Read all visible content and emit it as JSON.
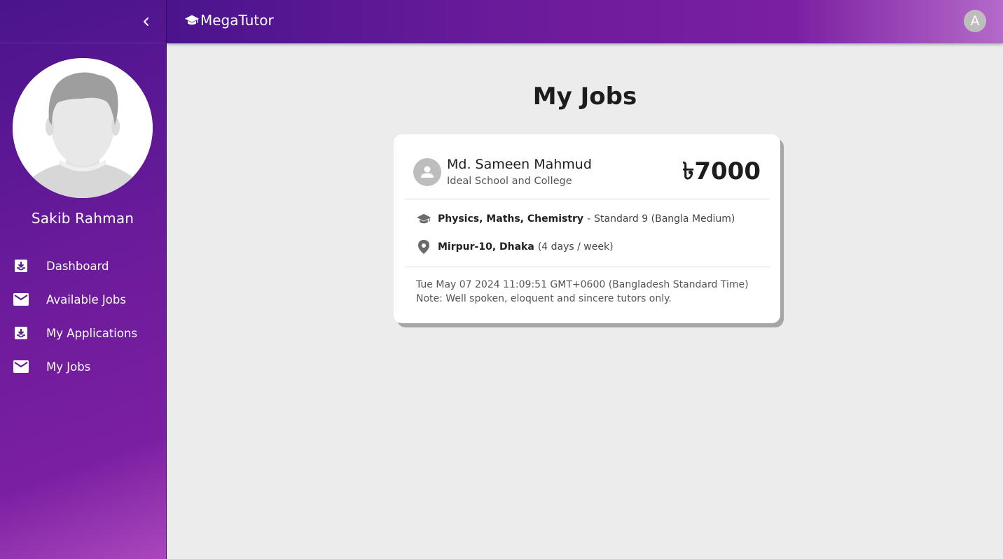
{
  "app": {
    "brand": "MegaTutor",
    "user_initial": "A"
  },
  "sidebar": {
    "user_name": "Sakib Rahman",
    "items": [
      {
        "label": "Dashboard",
        "icon": "inbox-download-icon"
      },
      {
        "label": "Available Jobs",
        "icon": "mail-icon"
      },
      {
        "label": "My Applications",
        "icon": "inbox-download-icon"
      },
      {
        "label": "My Jobs",
        "icon": "mail-icon"
      }
    ]
  },
  "main": {
    "title": "My Jobs",
    "job": {
      "poster_name": "Md. Sameen Mahmud",
      "school": "Ideal School and College",
      "salary": "৳7000",
      "subjects": "Physics, Maths, Chemistry",
      "class_sep": "-",
      "class_info": "Standard 9 (Bangla Medium)",
      "location": "Mirpur-10, Dhaka",
      "schedule": "(4 days / week)",
      "date": "Tue May 07 2024 11:09:51 GMT+0600 (Bangladesh Standard Time)",
      "note": "Note: Well spoken, eloquent and sincere tutors only."
    }
  },
  "colors": {
    "sidebar_gradient_start": "#4a148c",
    "sidebar_gradient_end": "#ab47bc",
    "page_bg": "#ececec",
    "card_shadow": "#a6a6a6"
  }
}
